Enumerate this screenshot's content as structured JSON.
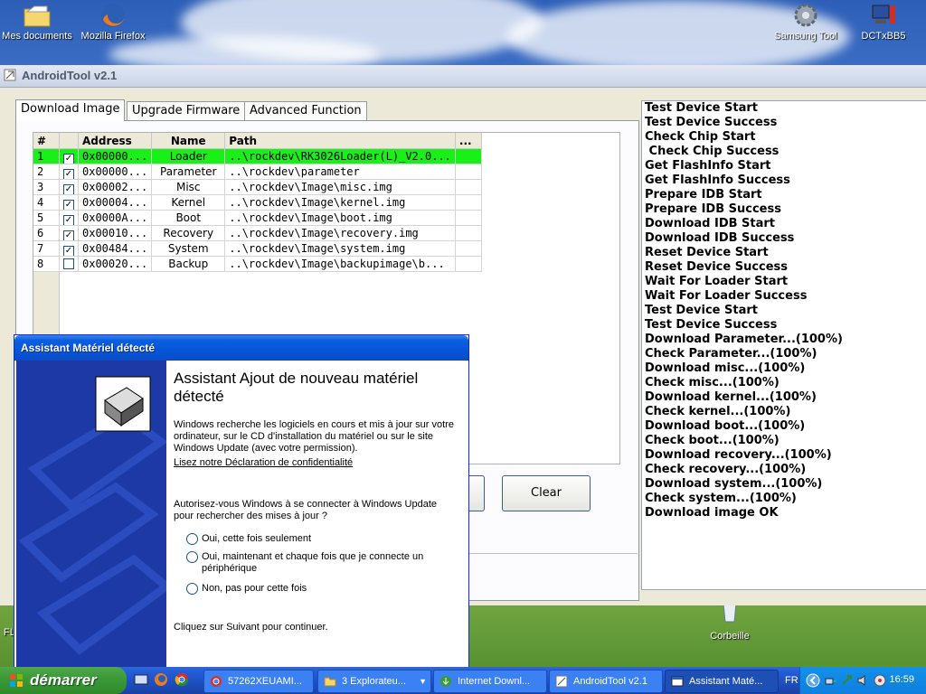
{
  "desktop": {
    "icons": [
      {
        "label": "Mes documents"
      },
      {
        "label": "Mozilla Firefox"
      },
      {
        "label": "Samsung Tool"
      },
      {
        "label": "DCTxBB5"
      },
      {
        "label": "Corbeille"
      }
    ],
    "partial_label": "FL"
  },
  "androidtool": {
    "title": "AndroidTool v2.1",
    "tabs": [
      "Download Image",
      "Upgrade Firmware",
      "Advanced Function"
    ],
    "columns": [
      "#",
      "",
      "Address",
      "Name",
      "Path",
      "..."
    ],
    "rows": [
      {
        "num": "1",
        "checked": true,
        "address": "0x00000...",
        "name": "Loader",
        "path": "..\\rockdev\\RK3026Loader(L)_V2.0...",
        "selected": true
      },
      {
        "num": "2",
        "checked": true,
        "address": "0x00000...",
        "name": "Parameter",
        "path": "..\\rockdev\\parameter",
        "selected": false
      },
      {
        "num": "3",
        "checked": true,
        "address": "0x00002...",
        "name": "Misc",
        "path": "..\\rockdev\\Image\\misc.img",
        "selected": false
      },
      {
        "num": "4",
        "checked": true,
        "address": "0x00004...",
        "name": "Kernel",
        "path": "..\\rockdev\\Image\\kernel.img",
        "selected": false
      },
      {
        "num": "5",
        "checked": true,
        "address": "0x0000A...",
        "name": "Boot",
        "path": "..\\rockdev\\Image\\boot.img",
        "selected": false
      },
      {
        "num": "6",
        "checked": true,
        "address": "0x00010...",
        "name": "Recovery",
        "path": "..\\rockdev\\Image\\recovery.img",
        "selected": false
      },
      {
        "num": "7",
        "checked": true,
        "address": "0x00484...",
        "name": "System",
        "path": "..\\rockdev\\Image\\system.img",
        "selected": false
      },
      {
        "num": "8",
        "checked": false,
        "address": "0x00020...",
        "name": "Backup",
        "path": "..\\rockdev\\Image\\backupimage\\b...",
        "selected": false
      }
    ],
    "clear_label": "Clear",
    "log": [
      "Test Device Start",
      "Test Device Success",
      "Check Chip Start",
      " Check Chip Success",
      "Get FlashInfo Start",
      "Get FlashInfo Success",
      "Prepare IDB Start",
      "Prepare IDB Success",
      "Download IDB Start",
      "Download IDB Success",
      "Reset Device Start",
      "Reset Device Success",
      "Wait For Loader Start",
      "Wait For Loader Success",
      "Test Device Start",
      "Test Device Success",
      "Download Parameter...(100%)",
      "Check Parameter...(100%)",
      "Download misc...(100%)",
      "Check misc...(100%)",
      "Download kernel...(100%)",
      "Check kernel...(100%)",
      "Download boot...(100%)",
      "Check boot...(100%)",
      "Download recovery...(100%)",
      "Check recovery...(100%)",
      "Download system...(100%)",
      "Check system...(100%)",
      "Download image OK"
    ]
  },
  "wizard": {
    "title": "Assistant Matériel détecté",
    "heading": "Assistant Ajout de nouveau matériel détecté",
    "intro": "Windows recherche les logiciels en cours et mis à jour sur votre ordinateur, sur le CD d'installation du matériel ou sur le site Windows Update (avec votre permission).",
    "privacy_link": "Lisez notre Déclaration de confidentialité",
    "question": "Autorisez-vous Windows à se connecter à Windows Update pour rechercher des mises à jour ?",
    "options": [
      "Oui, cette fois seulement",
      "Oui, maintenant et chaque fois que je connecte un périphérique",
      "Non, pas pour cette fois"
    ],
    "footer": "Cliquez sur Suivant pour continuer."
  },
  "taskbar": {
    "start_label": "démarrer",
    "buttons": [
      {
        "label": "57262XEUAMI..."
      },
      {
        "label": "3 Explorateu..."
      },
      {
        "label": "Internet Downl..."
      },
      {
        "label": "AndroidTool v2.1"
      },
      {
        "label": "Assistant Maté..."
      }
    ],
    "lang": "FR",
    "clock": "16:59"
  }
}
